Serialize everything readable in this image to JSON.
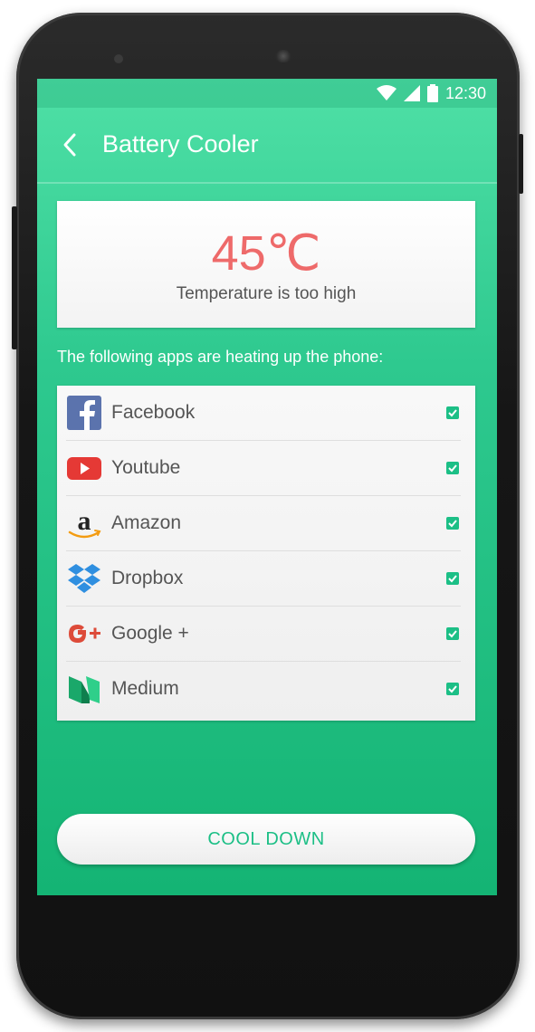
{
  "status_bar": {
    "time": "12:30",
    "icons": [
      "wifi-icon",
      "cell-signal-icon",
      "battery-icon"
    ]
  },
  "app_bar": {
    "title": "Battery Cooler",
    "back_icon": "chevron-left-icon"
  },
  "temperature": {
    "value": "45℃",
    "message": "Temperature is too high",
    "color": "#ee6a6a"
  },
  "apps_heading": "The following apps are heating up the phone:",
  "apps": [
    {
      "name": "Facebook",
      "icon": "facebook-icon",
      "checked": true
    },
    {
      "name": "Youtube",
      "icon": "youtube-icon",
      "checked": true
    },
    {
      "name": "Amazon",
      "icon": "amazon-icon",
      "checked": true
    },
    {
      "name": "Dropbox",
      "icon": "dropbox-icon",
      "checked": true
    },
    {
      "name": "Google +",
      "icon": "google-plus-icon",
      "checked": true
    },
    {
      "name": "Medium",
      "icon": "medium-icon",
      "checked": true
    }
  ],
  "action_button": {
    "label": "COOL DOWN"
  },
  "colors": {
    "accent": "#1cbf86",
    "screen_top": "#4fe0a6",
    "screen_bottom": "#14b474"
  }
}
